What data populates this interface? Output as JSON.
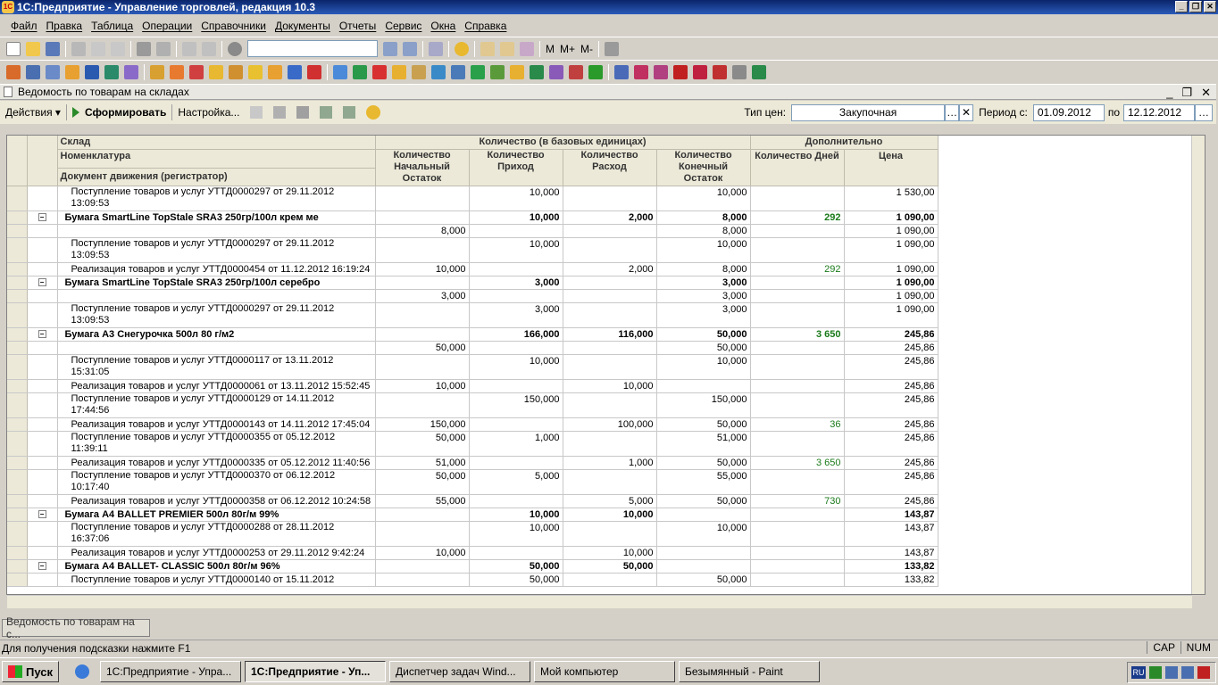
{
  "app": {
    "title": "1С:Предприятие - Управление торговлей, редакция 10.3"
  },
  "menu": [
    "Файл",
    "Правка",
    "Таблица",
    "Операции",
    "Справочники",
    "Документы",
    "Отчеты",
    "Сервис",
    "Окна",
    "Справка"
  ],
  "toolbar2_labels": [
    "M",
    "M+",
    "M-"
  ],
  "document": {
    "title": "Ведомость по товарам на складах"
  },
  "actions": {
    "actions_label": "Действия",
    "generate_label": "Сформировать",
    "settings_label": "Настройка...",
    "price_type_label": "Тип цен:",
    "price_type_value": "Закупочная",
    "period_label": "Период с:",
    "period_from": "01.09.2012",
    "period_to_label": "по",
    "period_to": "12.12.2012"
  },
  "headers": {
    "warehouse": "Склад",
    "nomenclature": "Номенклатура",
    "registrar": "Документ движения (регистратор)",
    "qty_group": "Количество (в базовых единицах)",
    "extra_group": "Дополнительно",
    "qty_start": "Количество Начальный Остаток",
    "qty_in": "Количество Приход",
    "qty_out": "Количество Расход",
    "qty_end": "Количество Конечный Остаток",
    "days": "Количество Дней",
    "price": "Цена"
  },
  "rows": [
    {
      "t": "doc",
      "name": "Поступление товаров и услуг УТТД0000297 от 29.11.2012 13:09:53",
      "s": "",
      "in": "10,000",
      "out": "",
      "e": "10,000",
      "d": "",
      "p": "1 530,00"
    },
    {
      "t": "grp",
      "name": "Бумага SmartLine TopStale SRA3  250гр/100л крем ме",
      "s": "",
      "in": "10,000",
      "out": "2,000",
      "e": "8,000",
      "d": "292",
      "p": "1 090,00"
    },
    {
      "t": "sub",
      "name": "",
      "s": "8,000",
      "in": "",
      "out": "",
      "e": "8,000",
      "d": "",
      "p": "1 090,00"
    },
    {
      "t": "doc",
      "name": "Поступление товаров и услуг УТТД0000297 от 29.11.2012 13:09:53",
      "s": "",
      "in": "10,000",
      "out": "",
      "e": "10,000",
      "d": "",
      "p": "1 090,00"
    },
    {
      "t": "doc1",
      "name": "Реализация товаров и услуг УТТД0000454 от 11.12.2012 16:19:24",
      "s": "10,000",
      "in": "",
      "out": "2,000",
      "e": "8,000",
      "d": "292",
      "p": "1 090,00"
    },
    {
      "t": "grp",
      "name": "Бумага SmartLine TopStale SRA3  250гр/100л серебро",
      "s": "",
      "in": "3,000",
      "out": "",
      "e": "3,000",
      "d": "",
      "p": "1 090,00"
    },
    {
      "t": "sub",
      "name": "",
      "s": "3,000",
      "in": "",
      "out": "",
      "e": "3,000",
      "d": "",
      "p": "1 090,00"
    },
    {
      "t": "doc",
      "name": "Поступление товаров и услуг УТТД0000297 от 29.11.2012 13:09:53",
      "s": "",
      "in": "3,000",
      "out": "",
      "e": "3,000",
      "d": "",
      "p": "1 090,00"
    },
    {
      "t": "grp",
      "name": "Бумага А3 Снегурочка 500л 80 г/м2",
      "s": "",
      "in": "166,000",
      "out": "116,000",
      "e": "50,000",
      "d": "3 650",
      "p": "245,86"
    },
    {
      "t": "sub",
      "name": "",
      "s": "50,000",
      "in": "",
      "out": "",
      "e": "50,000",
      "d": "",
      "p": "245,86"
    },
    {
      "t": "doc",
      "name": "Поступление товаров и услуг УТТД0000117 от 13.11.2012 15:31:05",
      "s": "",
      "in": "10,000",
      "out": "",
      "e": "10,000",
      "d": "",
      "p": "245,86"
    },
    {
      "t": "doc1",
      "name": "Реализация товаров и услуг УТТД0000061 от 13.11.2012 15:52:45",
      "s": "10,000",
      "in": "",
      "out": "10,000",
      "e": "",
      "d": "",
      "p": "245,86"
    },
    {
      "t": "doc",
      "name": "Поступление товаров и услуг УТТД0000129 от 14.11.2012 17:44:56",
      "s": "",
      "in": "150,000",
      "out": "",
      "e": "150,000",
      "d": "",
      "p": "245,86"
    },
    {
      "t": "doc1",
      "name": "Реализация товаров и услуг УТТД0000143 от 14.11.2012 17:45:04",
      "s": "150,000",
      "in": "",
      "out": "100,000",
      "e": "50,000",
      "d": "36",
      "p": "245,86"
    },
    {
      "t": "doc",
      "name": "Поступление товаров и услуг УТТД0000355 от 05.12.2012 11:39:11",
      "s": "50,000",
      "in": "1,000",
      "out": "",
      "e": "51,000",
      "d": "",
      "p": "245,86"
    },
    {
      "t": "doc1",
      "name": "Реализация товаров и услуг УТТД0000335 от 05.12.2012 11:40:56",
      "s": "51,000",
      "in": "",
      "out": "1,000",
      "e": "50,000",
      "d": "3 650",
      "p": "245,86"
    },
    {
      "t": "doc",
      "name": "Поступление товаров и услуг УТТД0000370 от 06.12.2012 10:17:40",
      "s": "50,000",
      "in": "5,000",
      "out": "",
      "e": "55,000",
      "d": "",
      "p": "245,86"
    },
    {
      "t": "doc1",
      "name": "Реализация товаров и услуг УТТД0000358 от 06.12.2012 10:24:58",
      "s": "55,000",
      "in": "",
      "out": "5,000",
      "e": "50,000",
      "d": "730",
      "p": "245,86"
    },
    {
      "t": "grp",
      "name": "Бумага А4 BALLET PREMIER 500л 80г/м 99%",
      "s": "",
      "in": "10,000",
      "out": "10,000",
      "e": "",
      "d": "",
      "p": "143,87"
    },
    {
      "t": "doc",
      "name": "Поступление товаров и услуг УТТД0000288 от 28.11.2012 16:37:06",
      "s": "",
      "in": "10,000",
      "out": "",
      "e": "10,000",
      "d": "",
      "p": "143,87"
    },
    {
      "t": "doc1",
      "name": "Реализация товаров и услуг УТТД0000253 от 29.11.2012 9:42:24",
      "s": "10,000",
      "in": "",
      "out": "10,000",
      "e": "",
      "d": "",
      "p": "143,87"
    },
    {
      "t": "grp",
      "name": "Бумага А4 BALLET- CLASSIC 500л 80г/м 96%",
      "s": "",
      "in": "50,000",
      "out": "50,000",
      "e": "",
      "d": "",
      "p": "133,82"
    },
    {
      "t": "doc1",
      "name": "Поступление товаров и услуг УТТД0000140 от 15.11.2012",
      "s": "",
      "in": "50,000",
      "out": "",
      "e": "50,000",
      "d": "",
      "p": "133,82"
    }
  ],
  "window_tab": "Ведомость по товарам на с...",
  "status": {
    "hint": "Для получения подсказки нажмите F1",
    "cap": "CAP",
    "num": "NUM"
  },
  "taskbar": {
    "start": "Пуск",
    "items": [
      "1С:Предприятие - Упра...",
      "1С:Предприятие - Уп...",
      "Диспетчер задач Wind...",
      "Мой компьютер",
      "Безымянный - Paint"
    ],
    "lang": "RU"
  },
  "colors": {
    "title_bar": "#0a246a",
    "green_value": "#1a7a1a",
    "grid_header": "#ece9d8"
  }
}
